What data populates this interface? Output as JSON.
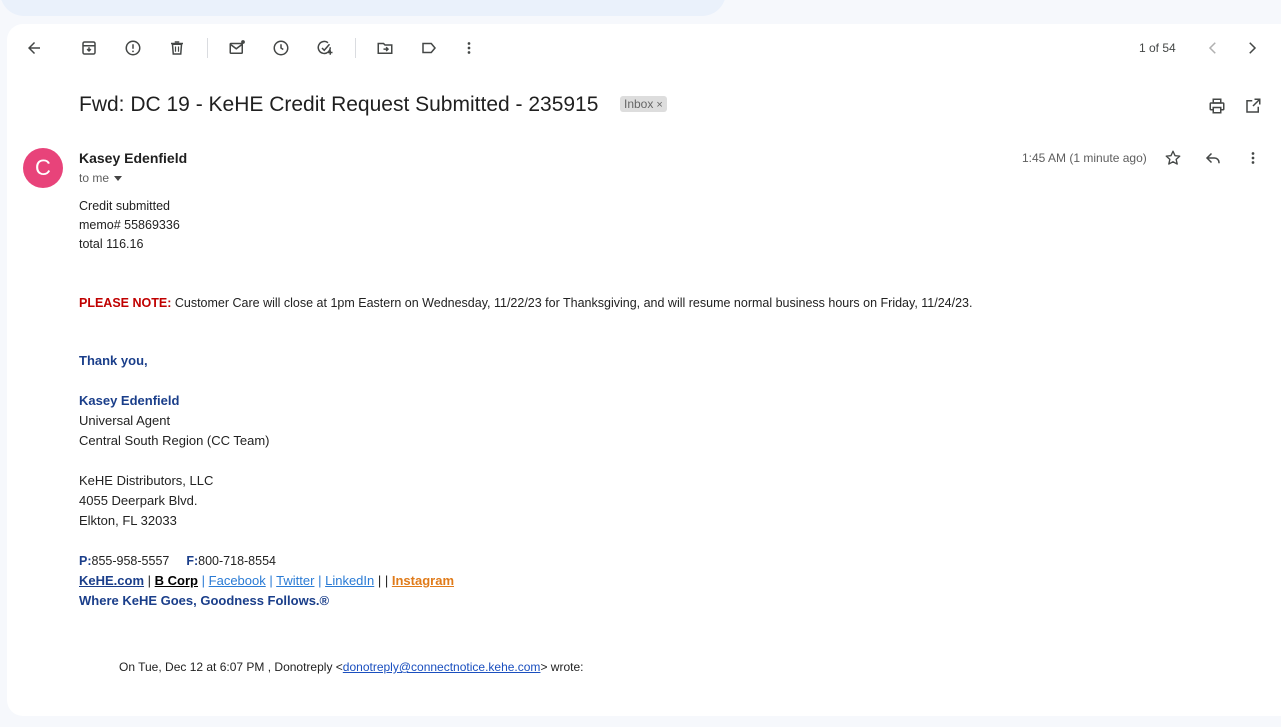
{
  "toolbar": {
    "icons": [
      "back-arrow-icon",
      "archive-icon",
      "report-spam-icon",
      "delete-icon",
      "mark-unread-icon",
      "snooze-icon",
      "add-to-tasks-icon",
      "move-to-icon",
      "labels-icon",
      "more-vert-icon"
    ],
    "page_count": "1 of 54"
  },
  "email": {
    "subject": "Fwd: DC 19 - KeHE Credit Request Submitted - 235915",
    "label_chip": "Inbox",
    "label_chip_close": "×",
    "avatar_letter": "C",
    "avatar_color": "#e8437a",
    "sender_name": "Kasey Edenfield",
    "to_line": "to me",
    "timestamp": "1:45 AM (1 minute ago)"
  },
  "body": {
    "line1": "Credit submitted",
    "line2": "memo# 55869336",
    "line3": "total 116.16",
    "note_label": "PLEASE NOTE:",
    "note_text": " Customer Care will close at 1pm Eastern on Wednesday, 11/22/23 for Thanksgiving, and will resume normal business hours on Friday, 11/24/23.",
    "thanks": "Thank you,",
    "sig_name": "Kasey Edenfield",
    "sig_title": "Universal Agent",
    "sig_region": "Central South Region (CC Team)",
    "company": "KeHE Distributors, LLC",
    "address1": "4055 Deerpark Blvd.",
    "address2": "Elkton, FL 32033",
    "phone_label": "P:",
    "phone": "855-958-5557",
    "fax_label": "F:",
    "fax": "800-718-8554",
    "link_kehe": "KeHE.com",
    "link_bcorp": "B Corp",
    "link_facebook": "Facebook",
    "link_twitter": "Twitter",
    "link_linkedin": "LinkedIn",
    "link_instagram": "Instagram",
    "sep": "|",
    "sep_double": "| |",
    "tagline": "Where KeHE Goes, Goodness Follows.®"
  },
  "quote": {
    "prefix": "On Tue, Dec 12 at 6:07 PM , Donotreply <",
    "email": "donotreply@connectnotice.kehe.com",
    "suffix": "> wrote:"
  },
  "colors": {
    "accent_red": "#c00000",
    "signature_blue": "#1a3e8a",
    "link_blue": "#2a7bd5",
    "instagram_orange": "#e07b1a"
  }
}
